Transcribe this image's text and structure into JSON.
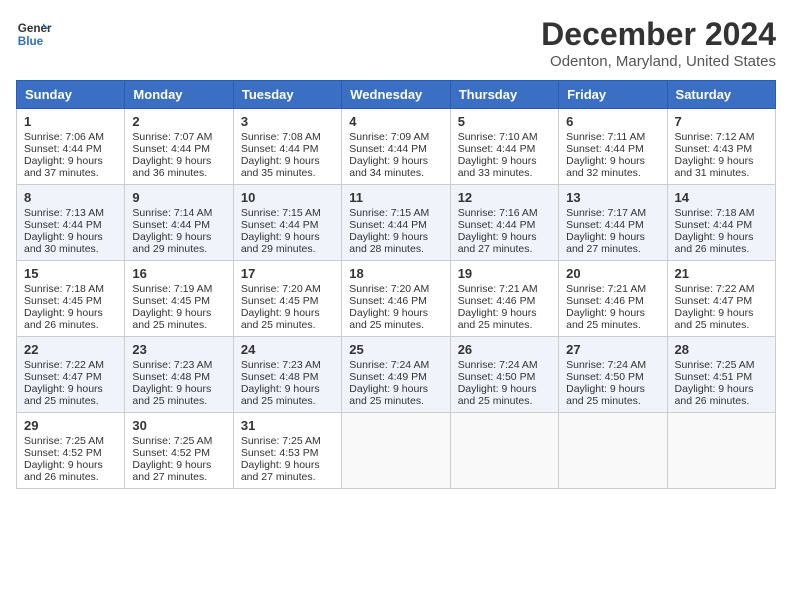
{
  "header": {
    "logo_line1": "General",
    "logo_line2": "Blue",
    "title": "December 2024",
    "subtitle": "Odenton, Maryland, United States"
  },
  "weekdays": [
    "Sunday",
    "Monday",
    "Tuesday",
    "Wednesday",
    "Thursday",
    "Friday",
    "Saturday"
  ],
  "weeks": [
    [
      {
        "day": "1",
        "sunrise": "Sunrise: 7:06 AM",
        "sunset": "Sunset: 4:44 PM",
        "daylight": "Daylight: 9 hours and 37 minutes."
      },
      {
        "day": "2",
        "sunrise": "Sunrise: 7:07 AM",
        "sunset": "Sunset: 4:44 PM",
        "daylight": "Daylight: 9 hours and 36 minutes."
      },
      {
        "day": "3",
        "sunrise": "Sunrise: 7:08 AM",
        "sunset": "Sunset: 4:44 PM",
        "daylight": "Daylight: 9 hours and 35 minutes."
      },
      {
        "day": "4",
        "sunrise": "Sunrise: 7:09 AM",
        "sunset": "Sunset: 4:44 PM",
        "daylight": "Daylight: 9 hours and 34 minutes."
      },
      {
        "day": "5",
        "sunrise": "Sunrise: 7:10 AM",
        "sunset": "Sunset: 4:44 PM",
        "daylight": "Daylight: 9 hours and 33 minutes."
      },
      {
        "day": "6",
        "sunrise": "Sunrise: 7:11 AM",
        "sunset": "Sunset: 4:44 PM",
        "daylight": "Daylight: 9 hours and 32 minutes."
      },
      {
        "day": "7",
        "sunrise": "Sunrise: 7:12 AM",
        "sunset": "Sunset: 4:43 PM",
        "daylight": "Daylight: 9 hours and 31 minutes."
      }
    ],
    [
      {
        "day": "8",
        "sunrise": "Sunrise: 7:13 AM",
        "sunset": "Sunset: 4:44 PM",
        "daylight": "Daylight: 9 hours and 30 minutes."
      },
      {
        "day": "9",
        "sunrise": "Sunrise: 7:14 AM",
        "sunset": "Sunset: 4:44 PM",
        "daylight": "Daylight: 9 hours and 29 minutes."
      },
      {
        "day": "10",
        "sunrise": "Sunrise: 7:15 AM",
        "sunset": "Sunset: 4:44 PM",
        "daylight": "Daylight: 9 hours and 29 minutes."
      },
      {
        "day": "11",
        "sunrise": "Sunrise: 7:15 AM",
        "sunset": "Sunset: 4:44 PM",
        "daylight": "Daylight: 9 hours and 28 minutes."
      },
      {
        "day": "12",
        "sunrise": "Sunrise: 7:16 AM",
        "sunset": "Sunset: 4:44 PM",
        "daylight": "Daylight: 9 hours and 27 minutes."
      },
      {
        "day": "13",
        "sunrise": "Sunrise: 7:17 AM",
        "sunset": "Sunset: 4:44 PM",
        "daylight": "Daylight: 9 hours and 27 minutes."
      },
      {
        "day": "14",
        "sunrise": "Sunrise: 7:18 AM",
        "sunset": "Sunset: 4:44 PM",
        "daylight": "Daylight: 9 hours and 26 minutes."
      }
    ],
    [
      {
        "day": "15",
        "sunrise": "Sunrise: 7:18 AM",
        "sunset": "Sunset: 4:45 PM",
        "daylight": "Daylight: 9 hours and 26 minutes."
      },
      {
        "day": "16",
        "sunrise": "Sunrise: 7:19 AM",
        "sunset": "Sunset: 4:45 PM",
        "daylight": "Daylight: 9 hours and 25 minutes."
      },
      {
        "day": "17",
        "sunrise": "Sunrise: 7:20 AM",
        "sunset": "Sunset: 4:45 PM",
        "daylight": "Daylight: 9 hours and 25 minutes."
      },
      {
        "day": "18",
        "sunrise": "Sunrise: 7:20 AM",
        "sunset": "Sunset: 4:46 PM",
        "daylight": "Daylight: 9 hours and 25 minutes."
      },
      {
        "day": "19",
        "sunrise": "Sunrise: 7:21 AM",
        "sunset": "Sunset: 4:46 PM",
        "daylight": "Daylight: 9 hours and 25 minutes."
      },
      {
        "day": "20",
        "sunrise": "Sunrise: 7:21 AM",
        "sunset": "Sunset: 4:46 PM",
        "daylight": "Daylight: 9 hours and 25 minutes."
      },
      {
        "day": "21",
        "sunrise": "Sunrise: 7:22 AM",
        "sunset": "Sunset: 4:47 PM",
        "daylight": "Daylight: 9 hours and 25 minutes."
      }
    ],
    [
      {
        "day": "22",
        "sunrise": "Sunrise: 7:22 AM",
        "sunset": "Sunset: 4:47 PM",
        "daylight": "Daylight: 9 hours and 25 minutes."
      },
      {
        "day": "23",
        "sunrise": "Sunrise: 7:23 AM",
        "sunset": "Sunset: 4:48 PM",
        "daylight": "Daylight: 9 hours and 25 minutes."
      },
      {
        "day": "24",
        "sunrise": "Sunrise: 7:23 AM",
        "sunset": "Sunset: 4:48 PM",
        "daylight": "Daylight: 9 hours and 25 minutes."
      },
      {
        "day": "25",
        "sunrise": "Sunrise: 7:24 AM",
        "sunset": "Sunset: 4:49 PM",
        "daylight": "Daylight: 9 hours and 25 minutes."
      },
      {
        "day": "26",
        "sunrise": "Sunrise: 7:24 AM",
        "sunset": "Sunset: 4:50 PM",
        "daylight": "Daylight: 9 hours and 25 minutes."
      },
      {
        "day": "27",
        "sunrise": "Sunrise: 7:24 AM",
        "sunset": "Sunset: 4:50 PM",
        "daylight": "Daylight: 9 hours and 25 minutes."
      },
      {
        "day": "28",
        "sunrise": "Sunrise: 7:25 AM",
        "sunset": "Sunset: 4:51 PM",
        "daylight": "Daylight: 9 hours and 26 minutes."
      }
    ],
    [
      {
        "day": "29",
        "sunrise": "Sunrise: 7:25 AM",
        "sunset": "Sunset: 4:52 PM",
        "daylight": "Daylight: 9 hours and 26 minutes."
      },
      {
        "day": "30",
        "sunrise": "Sunrise: 7:25 AM",
        "sunset": "Sunset: 4:52 PM",
        "daylight": "Daylight: 9 hours and 27 minutes."
      },
      {
        "day": "31",
        "sunrise": "Sunrise: 7:25 AM",
        "sunset": "Sunset: 4:53 PM",
        "daylight": "Daylight: 9 hours and 27 minutes."
      },
      null,
      null,
      null,
      null
    ]
  ]
}
